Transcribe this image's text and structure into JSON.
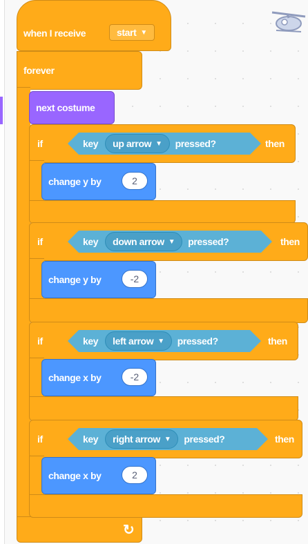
{
  "hat": {
    "label": "when I receive",
    "message": "start"
  },
  "forever": {
    "label": "forever"
  },
  "looks": {
    "label": "next costume"
  },
  "if_blocks": [
    {
      "if_label": "if",
      "key_label": "key",
      "key": "up arrow",
      "pressed_label": "pressed?",
      "then_label": "then",
      "action": "change y by",
      "value": "2"
    },
    {
      "if_label": "if",
      "key_label": "key",
      "key": "down arrow",
      "pressed_label": "pressed?",
      "then_label": "then",
      "action": "change y by",
      "value": "-2"
    },
    {
      "if_label": "if",
      "key_label": "key",
      "key": "left arrow",
      "pressed_label": "pressed?",
      "then_label": "then",
      "action": "change x by",
      "value": "-2"
    },
    {
      "if_label": "if",
      "key_label": "key",
      "key": "right arrow",
      "pressed_label": "pressed?",
      "then_label": "then",
      "action": "change x by",
      "value": "2"
    }
  ],
  "icons": {
    "loop": "↻",
    "dropdown": "▾",
    "sprite_thumbnail": "helicopter-sprite-icon"
  },
  "colors": {
    "events": "#ffab19",
    "control": "#ffab19",
    "looks": "#9966ff",
    "motion": "#4c97ff",
    "sensing": "#5cb1d6"
  }
}
